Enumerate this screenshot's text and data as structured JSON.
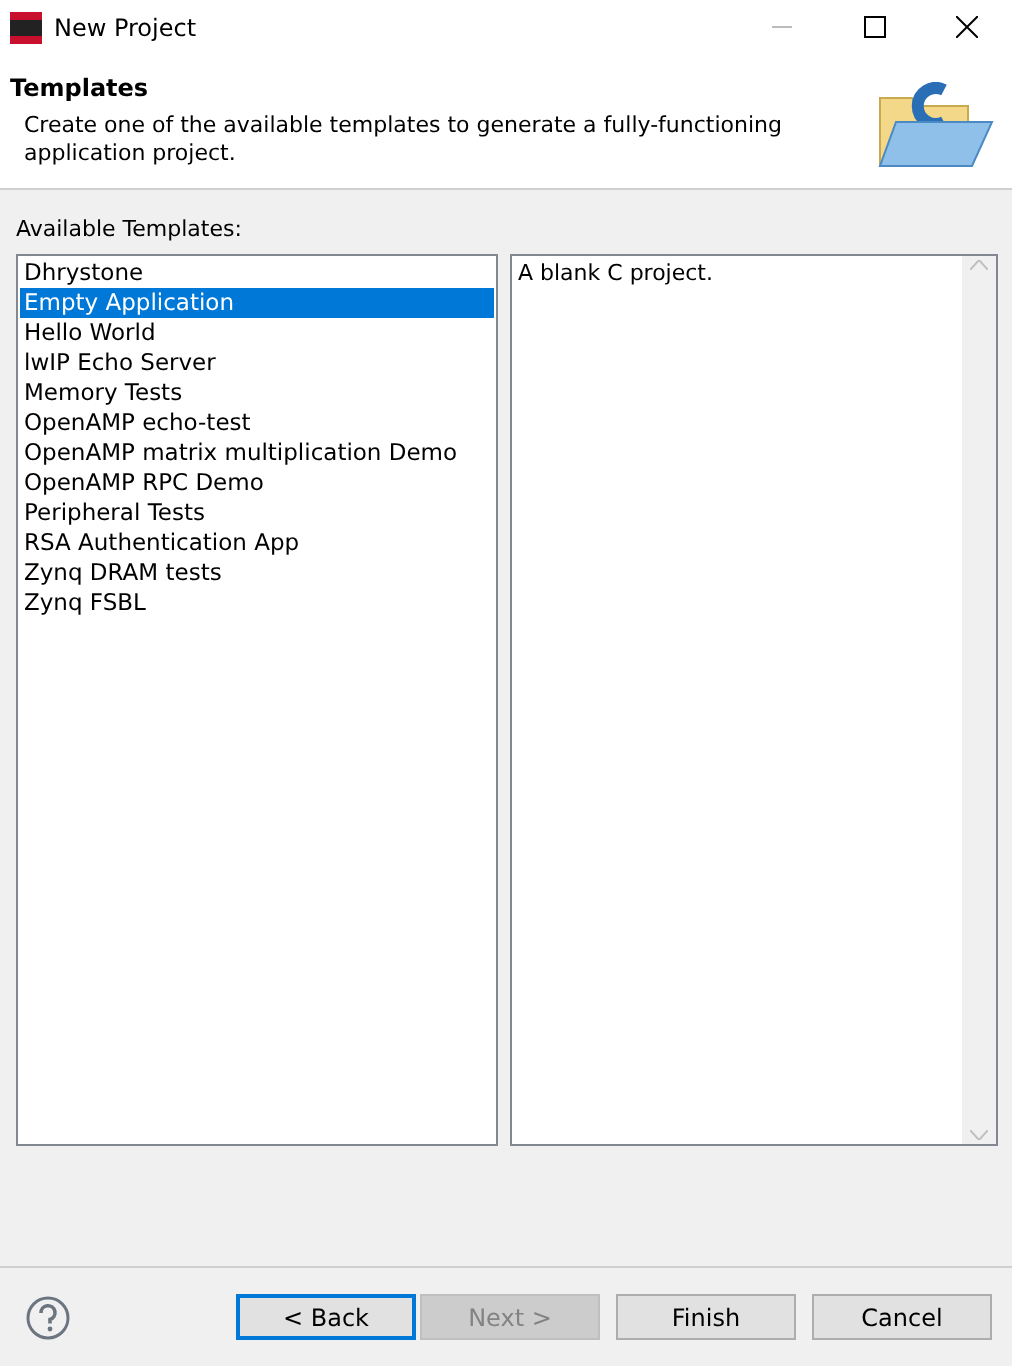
{
  "window": {
    "title": "New Project"
  },
  "header": {
    "title": "Templates",
    "description": "Create one of the available templates to generate a fully-functioning application project."
  },
  "templates": {
    "label": "Available Templates:",
    "items": [
      {
        "label": "Dhrystone",
        "selected": false
      },
      {
        "label": "Empty Application",
        "selected": true
      },
      {
        "label": "Hello World",
        "selected": false
      },
      {
        "label": "lwIP Echo Server",
        "selected": false
      },
      {
        "label": "Memory Tests",
        "selected": false
      },
      {
        "label": "OpenAMP echo-test",
        "selected": false
      },
      {
        "label": "OpenAMP matrix multiplication Demo",
        "selected": false
      },
      {
        "label": "OpenAMP RPC Demo",
        "selected": false
      },
      {
        "label": "Peripheral Tests",
        "selected": false
      },
      {
        "label": "RSA Authentication App",
        "selected": false
      },
      {
        "label": "Zynq DRAM tests",
        "selected": false
      },
      {
        "label": "Zynq FSBL",
        "selected": false
      }
    ]
  },
  "description_panel": {
    "text": "A blank C project."
  },
  "buttons": [
    {
      "label": "< Back",
      "disabled": false,
      "focused": true
    },
    {
      "label": "Next >",
      "disabled": true,
      "focused": false
    },
    {
      "label": "Finish",
      "disabled": false,
      "focused": false
    },
    {
      "label": "Cancel",
      "disabled": false,
      "focused": false
    }
  ]
}
